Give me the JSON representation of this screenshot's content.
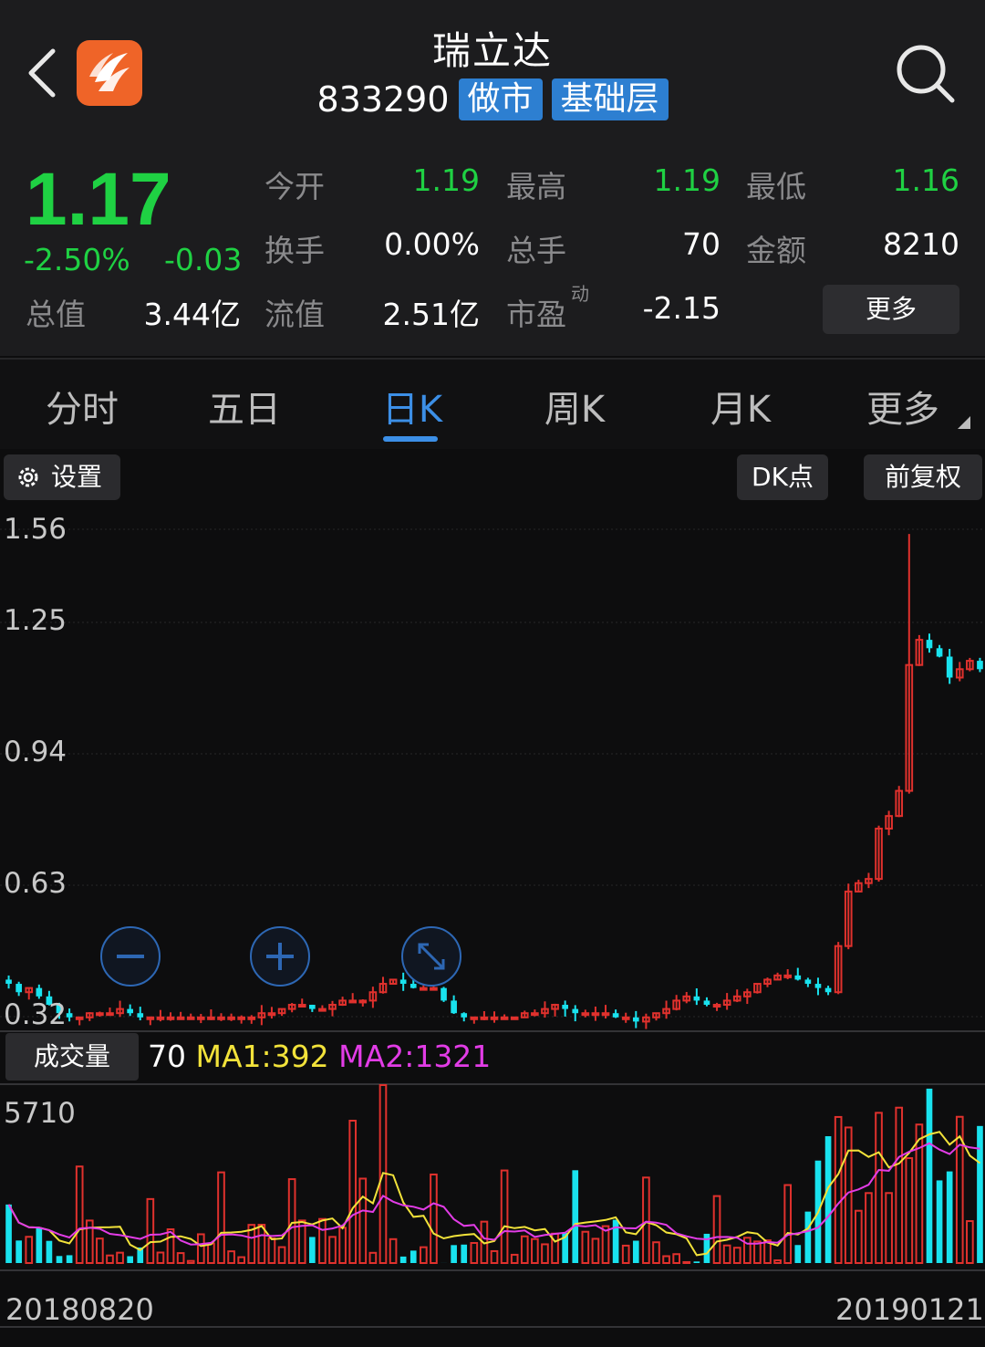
{
  "header": {
    "stock_name": "瑞立达",
    "stock_code": "833290",
    "tags": [
      "做市",
      "基础层"
    ]
  },
  "quote": {
    "price": "1.17",
    "change_pct": "-2.50%",
    "change": "-0.03",
    "open_label": "今开",
    "open": "1.19",
    "high_label": "最高",
    "high": "1.19",
    "low_label": "最低",
    "low": "1.16",
    "turnover_label": "换手",
    "turnover": "0.00%",
    "volume_label": "总手",
    "volume": "70",
    "amount_label": "金额",
    "amount": "8210",
    "mktcap_label": "总值",
    "mktcap": "3.44亿",
    "float_label": "流值",
    "float": "2.51亿",
    "pe_label": "市盈",
    "pe_sup": "动",
    "pe": "-2.15",
    "more_button": "更多"
  },
  "tabs": [
    "分时",
    "五日",
    "日K",
    "周K",
    "月K",
    "更多"
  ],
  "active_tab": "日K",
  "toolbar": {
    "settings": "设置",
    "dk": "DK点",
    "adjust": "前复权"
  },
  "volume_panel": {
    "label": "成交量",
    "current": "70",
    "ma1": "MA1:392",
    "ma2": "MA2:1321",
    "ymax": "5710"
  },
  "colors": {
    "up": "#e0312d",
    "down": "#19e2ee",
    "price_green": "#1fd143",
    "ma1": "#f2e23a",
    "ma2": "#e23ce6",
    "accent": "#3c8fe6"
  },
  "chart_data": {
    "type": "candlestick",
    "y_ticks": [
      "1.56",
      "1.25",
      "0.94",
      "0.63",
      "0.32"
    ],
    "x_start": "20180820",
    "x_end": "20190121",
    "ylim": [
      0.32,
      1.56
    ],
    "closes": [
      0.42,
      0.4,
      0.41,
      0.39,
      0.37,
      0.35,
      0.34,
      0.34,
      0.35,
      0.35,
      0.35,
      0.36,
      0.35,
      0.34,
      0.34,
      0.34,
      0.34,
      0.34,
      0.34,
      0.34,
      0.34,
      0.34,
      0.34,
      0.34,
      0.34,
      0.35,
      0.35,
      0.36,
      0.37,
      0.37,
      0.36,
      0.36,
      0.37,
      0.38,
      0.38,
      0.38,
      0.4,
      0.42,
      0.43,
      0.42,
      0.41,
      0.41,
      0.41,
      0.38,
      0.35,
      0.34,
      0.34,
      0.34,
      0.34,
      0.34,
      0.34,
      0.35,
      0.35,
      0.36,
      0.37,
      0.36,
      0.35,
      0.35,
      0.35,
      0.35,
      0.34,
      0.34,
      0.33,
      0.34,
      0.35,
      0.36,
      0.38,
      0.39,
      0.38,
      0.37,
      0.37,
      0.38,
      0.39,
      0.4,
      0.42,
      0.43,
      0.44,
      0.44,
      0.43,
      0.42,
      0.41,
      0.4,
      0.51,
      0.64,
      0.66,
      0.67,
      0.79,
      0.82,
      0.88,
      1.18,
      1.24,
      1.22,
      1.2,
      1.15,
      1.17,
      1.19,
      1.17
    ]
  }
}
